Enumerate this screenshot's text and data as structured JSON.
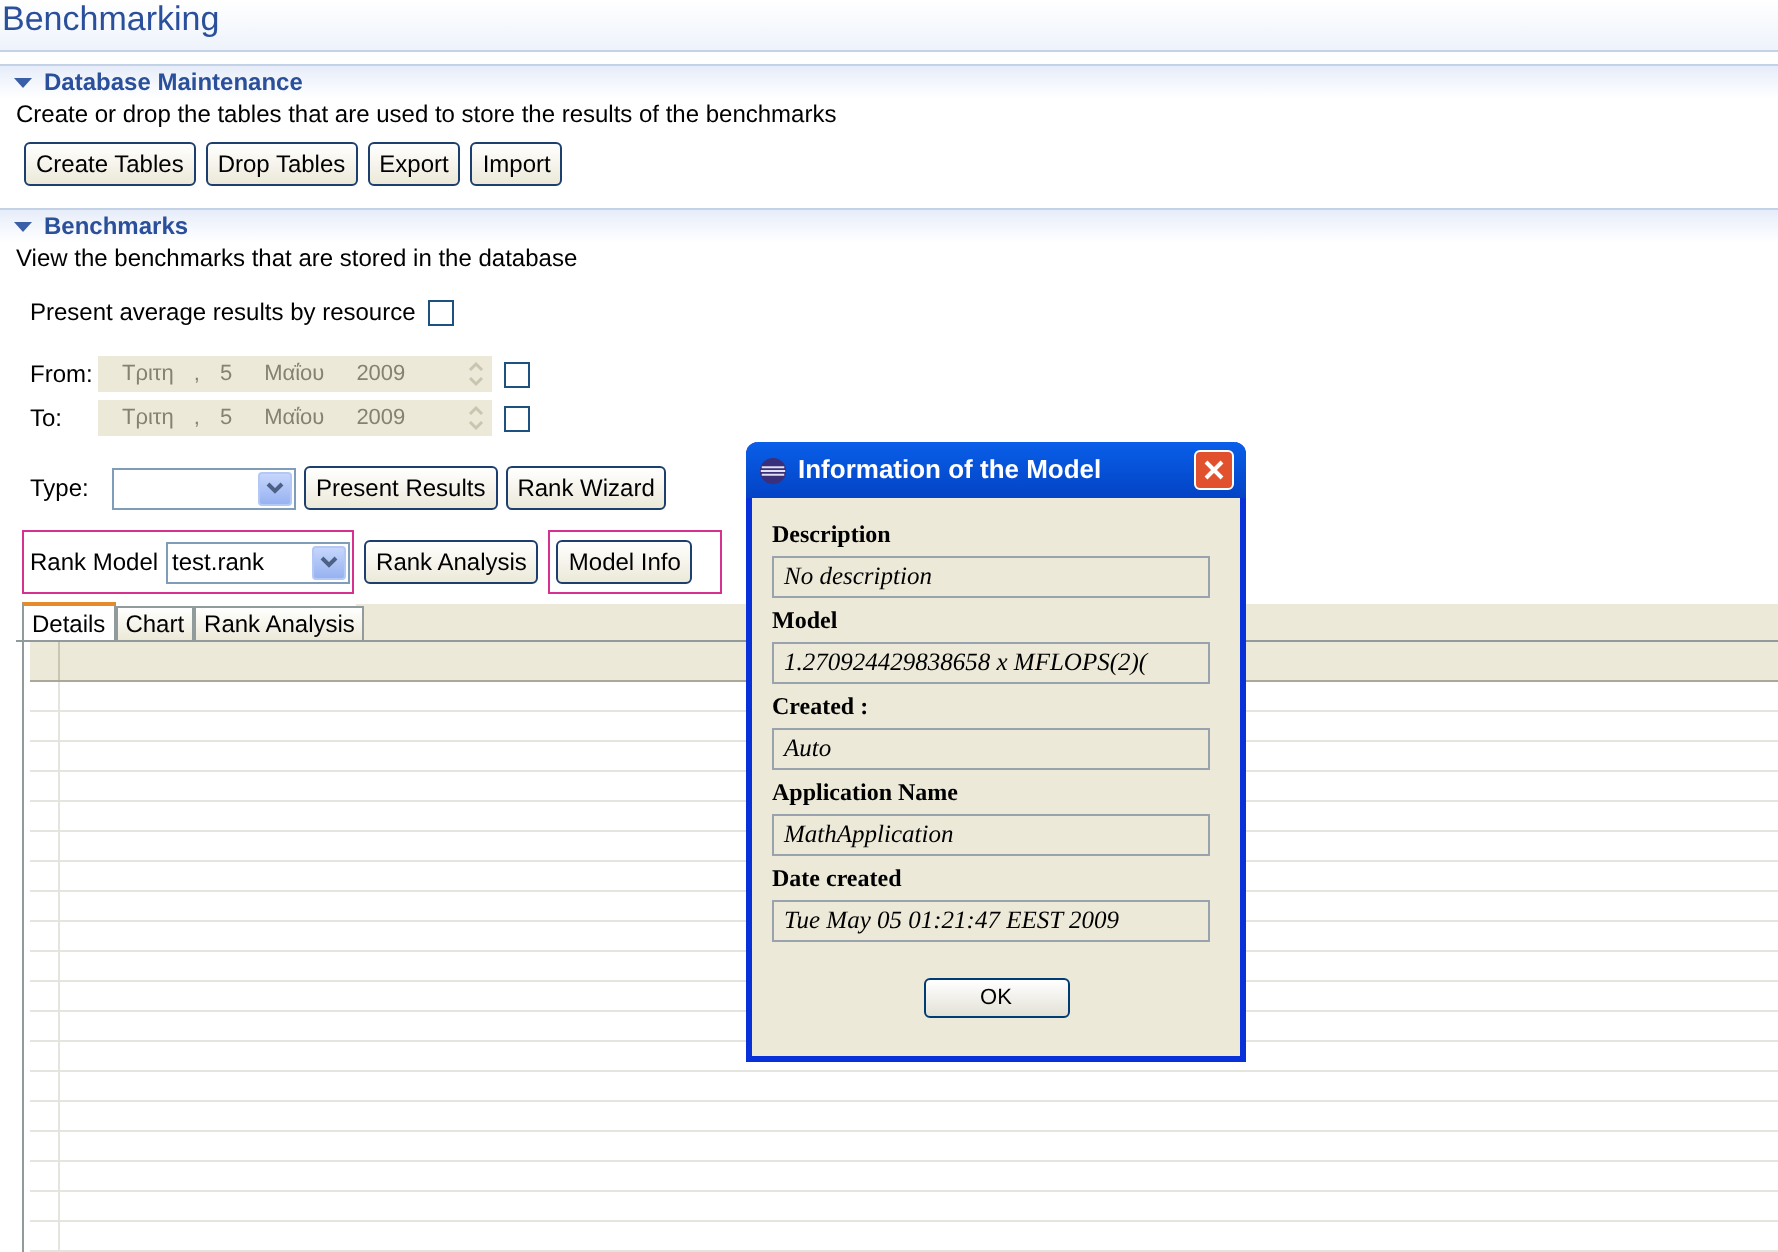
{
  "page_title": "Benchmarking",
  "maintenance": {
    "title": "Database Maintenance",
    "expanded": true,
    "description": "Create or drop the tables that are used to store the results of the benchmarks",
    "buttons": [
      "Create Tables",
      "Drop Tables",
      "Export",
      "Import"
    ]
  },
  "benchmarks": {
    "title": "Benchmarks",
    "expanded": true,
    "description": "View the benchmarks that are stored in the database",
    "average_option": {
      "label": "Present average results by resource",
      "checked": false
    },
    "dates": [
      {
        "label": "From:",
        "day_name": "Τριτη",
        "separator": ",",
        "day": "5",
        "month": "Μαΐου",
        "year": "2009",
        "disabled": true,
        "checked": false
      },
      {
        "label": "To:",
        "day_name": "Τριτη",
        "separator": ",",
        "day": "5",
        "month": "Μαΐου",
        "year": "2009",
        "disabled": true,
        "checked": false
      }
    ],
    "type": {
      "label": "Type:",
      "buttons": [
        "Present Results",
        "Rank Wizard"
      ]
    },
    "rank_model": {
      "label": "Rank Model",
      "value": "test.rank",
      "buttons": [
        "Rank Analysis",
        "Model Info"
      ]
    },
    "tabs": [
      {
        "label": "Details",
        "selected": true
      },
      {
        "label": "Chart",
        "selected": false
      },
      {
        "label": "Rank Analysis",
        "selected": false
      }
    ]
  },
  "dialog": {
    "title": "Information of the Model",
    "fields": [
      {
        "label": "Description",
        "value": "No description"
      },
      {
        "label": "Model",
        "value": "1.270924429838658 x MFLOPS(2)("
      },
      {
        "label": "Created :",
        "value": "Auto"
      },
      {
        "label": "Application Name",
        "value": "MathApplication"
      },
      {
        "label": "Date created",
        "value": "Tue May 05 01:21:47 EEST 2009"
      }
    ],
    "button": "OK"
  }
}
